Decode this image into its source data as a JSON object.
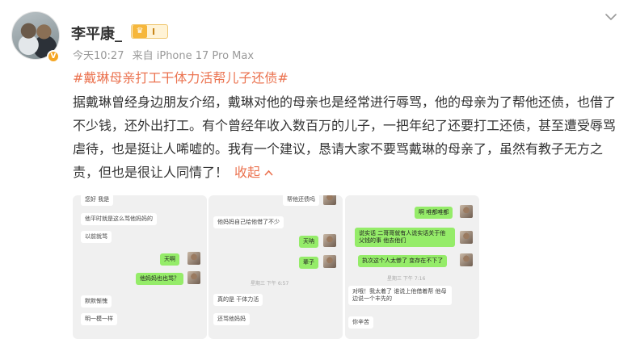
{
  "post": {
    "username": "李平康_",
    "level_badge": "I",
    "verified_badge": "V",
    "time": "今天10:27",
    "source": "来自 iPhone 17 Pro Max",
    "topic": "#戴琳母亲打工干体力活帮儿子还债#",
    "body": "据戴琳曾经身边朋友介绍，戴琳对他的母亲也是经常进行辱骂，他的母亲为了帮他还债，也借了不少钱，还外出打工。有个曾经年收入数百万的儿子，一把年纪了还要打工还债，甚至遭受辱骂虐待，也是挺让人唏嘘的。我有一个建议，恳请大家不要骂戴琳的母亲了，虽然有教子无方之责，但也是很让人同情了！",
    "collapse_label": "收起"
  },
  "images": {
    "shot1": {
      "m1": "您好 我是",
      "m2": "他平时就是这么骂他妈妈的",
      "m3": "以前就骂",
      "m4": "天啊",
      "m5": "他妈妈也也骂？",
      "m6": "默默惭愧",
      "m7": "明一模一样"
    },
    "shot2": {
      "m1": "帮他还债吗",
      "m2": "他妈妈自己给他借了不少",
      "m3": "天呐",
      "m4": "辈子",
      "time": "星期三 下午 6:57",
      "m5": "真的是  干体力活",
      "m6": "还骂他妈妈"
    },
    "shot3": {
      "m1": "啊  唯都唯都",
      "m2": "说实话 二哥哥就有人说实话关于他父钱的事 他去他们",
      "m3": "执次这个人太惨了 变存在不下了",
      "time": "星期三 下午 7:16",
      "m4": "对哦！我太着了  谁说上他借着帮  他母边说一个丰先的",
      "m5": "你辛苦"
    }
  }
}
